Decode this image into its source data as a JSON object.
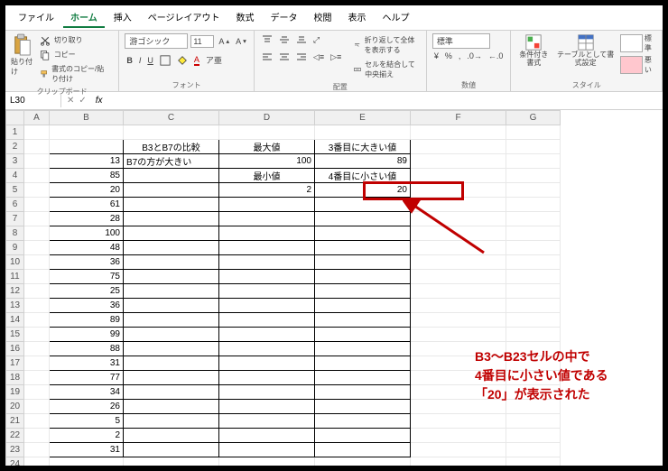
{
  "menu": {
    "file": "ファイル",
    "home": "ホーム",
    "insert": "挿入",
    "layout": "ページレイアウト",
    "formula": "数式",
    "data": "データ",
    "review": "校閲",
    "view": "表示",
    "help": "ヘルプ"
  },
  "ribbon": {
    "paste": "貼り付け",
    "cut": "切り取り",
    "copy": "コピー",
    "fmtpaint": "書式のコピー/貼り付け",
    "g_clip": "クリップボード",
    "g_font": "フォント",
    "g_align": "配置",
    "g_num": "数値",
    "g_style": "スタイル",
    "font": "游ゴシック",
    "size": "11",
    "wrap": "折り返して全体を表示する",
    "merge": "セルを結合して中央揃え",
    "numfmt": "標準",
    "cond": "条件付き書式",
    "tbl": "テーブルとして書式設定",
    "stdcell": "標準",
    "badcell": "悪い"
  },
  "namebox": {
    "cell": "L30"
  },
  "cols": [
    "A",
    "B",
    "C",
    "D",
    "E",
    "F",
    "G"
  ],
  "headers": {
    "c2": "B3とB7の比較",
    "d2": "最大値",
    "e2": "3番目に大きい値",
    "d4": "最小値",
    "e4": "4番目に小さい値"
  },
  "vals": {
    "b3": "13",
    "c3": "B7の方が大きい",
    "d3": "100",
    "e3": "89",
    "b4": "85",
    "b5": "20",
    "d5": "2",
    "e5": "20",
    "b6": "61",
    "b7": "28",
    "b8": "100",
    "b9": "48",
    "b10": "36",
    "b11": "75",
    "b12": "25",
    "b13": "36",
    "b14": "89",
    "b15": "99",
    "b16": "88",
    "b17": "31",
    "b18": "77",
    "b19": "34",
    "b20": "26",
    "b21": "5",
    "b22": "2",
    "b23": "31"
  },
  "annotation": "B3～B23セルの中で\n4番目に小さい値である\n「20」が表示された"
}
